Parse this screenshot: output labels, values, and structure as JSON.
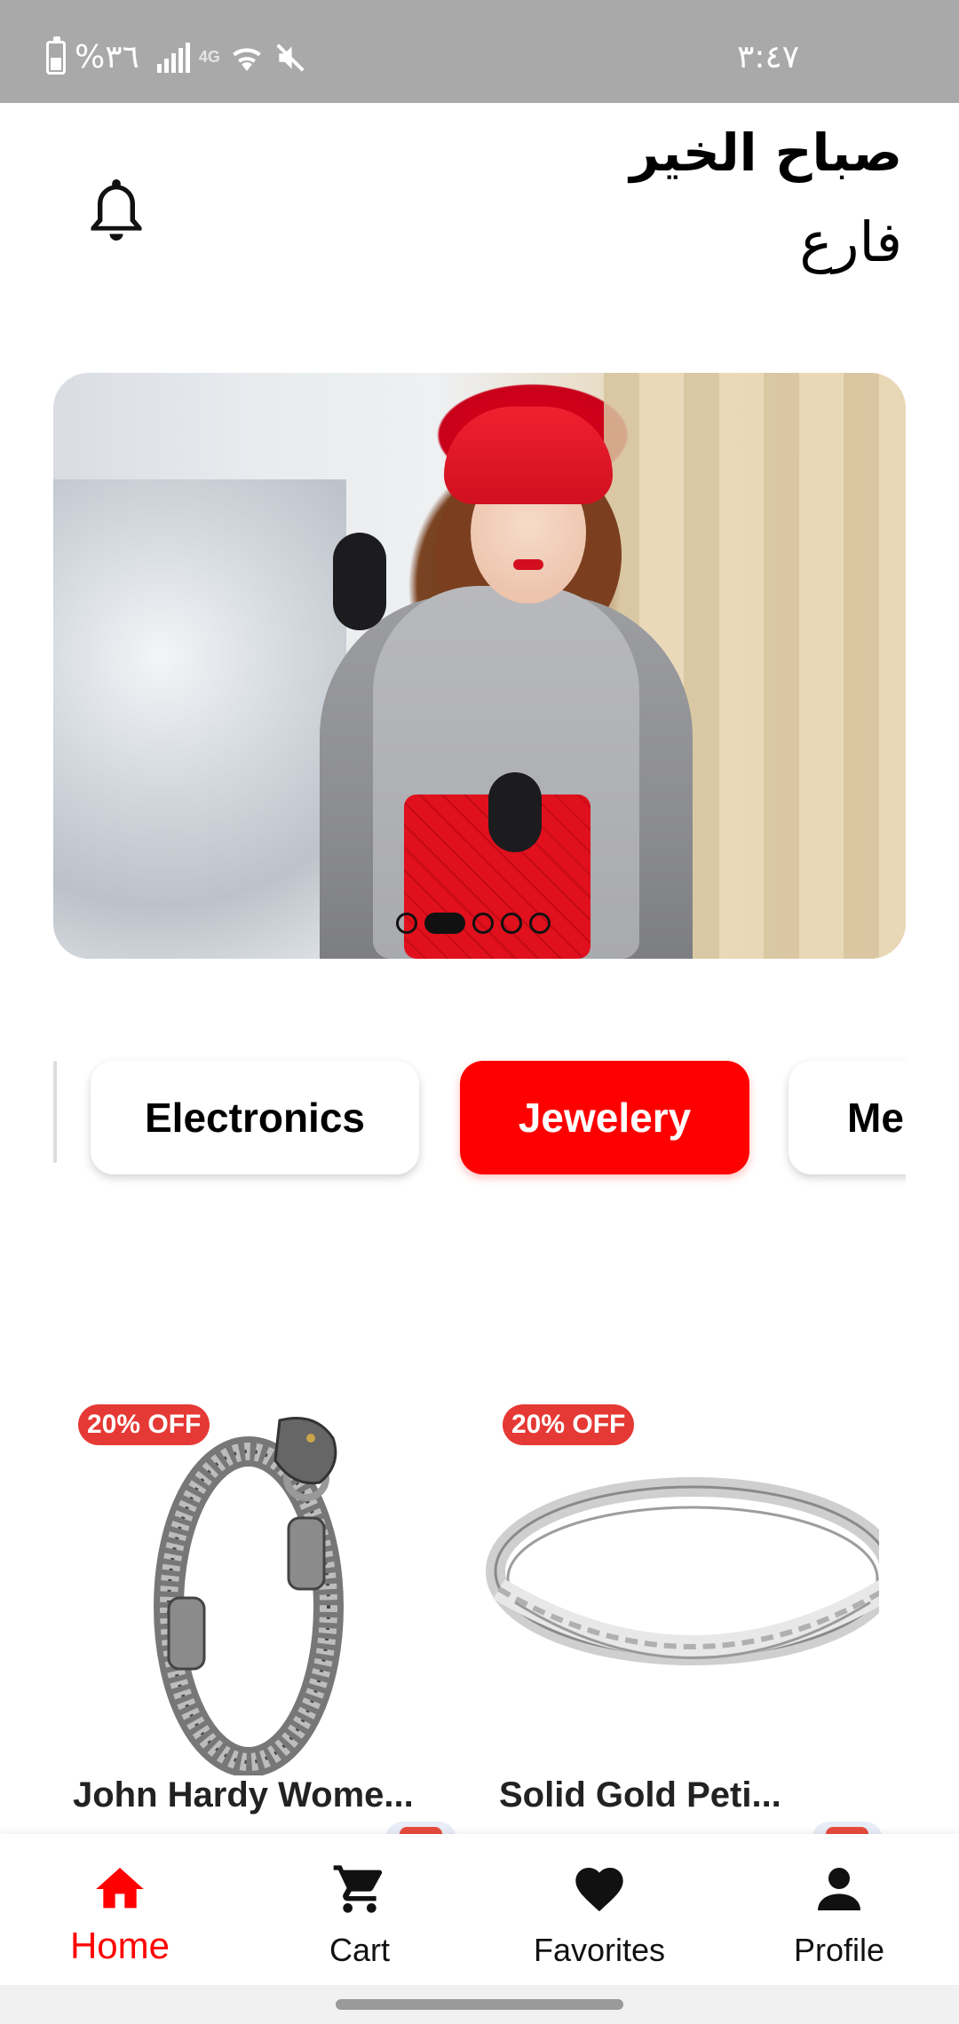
{
  "status_bar": {
    "time": "٣:٤٧",
    "battery": "%٣٦",
    "network": "4G"
  },
  "header": {
    "greeting": "صباح الخير",
    "name": "فارع",
    "notification_icon": "bell-icon"
  },
  "banner": {
    "image_description_icon": "promo-photo",
    "slide_count": 5,
    "active_slide": 2
  },
  "categories": [
    {
      "label": "Electronics",
      "active": false
    },
    {
      "label": "Jewelery",
      "active": true
    },
    {
      "label": "Me",
      "active": false
    }
  ],
  "products": [
    {
      "name": "John Hardy Wome...",
      "discount": "20% OFF",
      "icon": "bracelet-image"
    },
    {
      "name": "Solid Gold Peti...",
      "discount": "20% OFF",
      "icon": "ring-image"
    }
  ],
  "bottom_nav": [
    {
      "label": "Home",
      "icon": "home-icon",
      "active": true
    },
    {
      "label": "Cart",
      "icon": "cart-icon",
      "active": false
    },
    {
      "label": "Favorites",
      "icon": "heart-icon",
      "active": false
    },
    {
      "label": "Profile",
      "icon": "person-icon",
      "active": false
    }
  ],
  "colors": {
    "accent": "#ff0000",
    "badge": "#e53935",
    "status_bar": "#a9a9a9"
  }
}
